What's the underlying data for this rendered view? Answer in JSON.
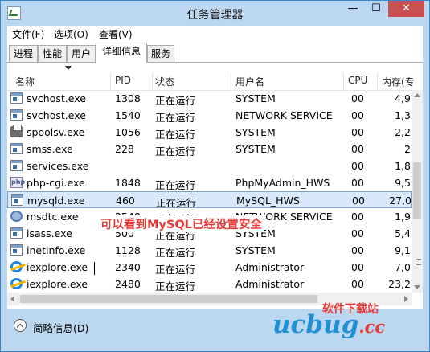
{
  "window": {
    "title": "任务管理器",
    "btn_min": "—",
    "btn_max": "☐",
    "btn_close": "✕"
  },
  "menu": [
    "文件(F)",
    "选项(O)",
    "查看(V)"
  ],
  "tabs": [
    {
      "label": "进程",
      "active": false
    },
    {
      "label": "性能",
      "active": false
    },
    {
      "label": "用户",
      "active": false
    },
    {
      "label": "详细信息",
      "active": true
    },
    {
      "label": "服务",
      "active": false
    }
  ],
  "columns": {
    "name": "名称",
    "pid": "PID",
    "status": "状态",
    "user": "用户名",
    "cpu": "CPU",
    "mem": "内存(专"
  },
  "rows": [
    {
      "icon": "window-icon",
      "name": "svchost.exe",
      "pid": "1308",
      "status": "正在运行",
      "user": "SYSTEM",
      "cpu": "00",
      "mem": "4,9"
    },
    {
      "icon": "window-icon",
      "name": "svchost.exe",
      "pid": "1540",
      "status": "正在运行",
      "user": "NETWORK SERVICE",
      "cpu": "00",
      "mem": "1,3"
    },
    {
      "icon": "printer-icon",
      "name": "spoolsv.exe",
      "pid": "1056",
      "status": "正在运行",
      "user": "SYSTEM",
      "cpu": "00",
      "mem": "2,2"
    },
    {
      "icon": "window-icon",
      "name": "smss.exe",
      "pid": "228",
      "status": "正在运行",
      "user": "SYSTEM",
      "cpu": "00",
      "mem": "2"
    },
    {
      "icon": "window-icon",
      "name": "services.exe",
      "pid": "",
      "status": "",
      "user": "",
      "cpu": "00",
      "mem": "1,8"
    },
    {
      "icon": "php-icon",
      "name": "php-cgi.exe",
      "pid": "1848",
      "status": "正在运行",
      "user": "PhpMyAdmin_HWS",
      "cpu": "00",
      "mem": "9,5"
    },
    {
      "icon": "window-icon",
      "name": "mysqld.exe",
      "pid": "460",
      "status": "正在运行",
      "user": "MySQL_HWS",
      "cpu": "00",
      "mem": "27,0",
      "selected": true
    },
    {
      "icon": "gear-icon",
      "name": "msdtc.exe",
      "pid": "2548",
      "status": "正在运行",
      "user": "NETWORK SERVICE",
      "cpu": "00",
      "mem": "1,9"
    },
    {
      "icon": "window-icon",
      "name": "lsass.exe",
      "pid": "500",
      "status": "正在运行",
      "user": "SYSTEM",
      "cpu": "00",
      "mem": "5,4"
    },
    {
      "icon": "window-icon",
      "name": "inetinfo.exe",
      "pid": "1128",
      "status": "正在运行",
      "user": "SYSTEM",
      "cpu": "00",
      "mem": "9,1"
    },
    {
      "icon": "ie-icon",
      "name": "iexplore.exe",
      "pid": "2340",
      "status": "正在运行",
      "user": "Administrator",
      "cpu": "00",
      "mem": "7,0"
    },
    {
      "icon": "ie-icon",
      "name": "iexplore.exe",
      "pid": "2480",
      "status": "正在运行",
      "user": "Administrator",
      "cpu": "00",
      "mem": "23,2"
    }
  ],
  "annotation": "可以看到MySQL已经设置安全",
  "footer": {
    "label": "简略信息(D)"
  },
  "watermark": {
    "top": "软件下载站",
    "logo": "ucbug",
    "domain": ".cc"
  },
  "colors": {
    "selection": "#d9e8fb",
    "annotation": "#e53935",
    "close_button": "#c75050"
  }
}
